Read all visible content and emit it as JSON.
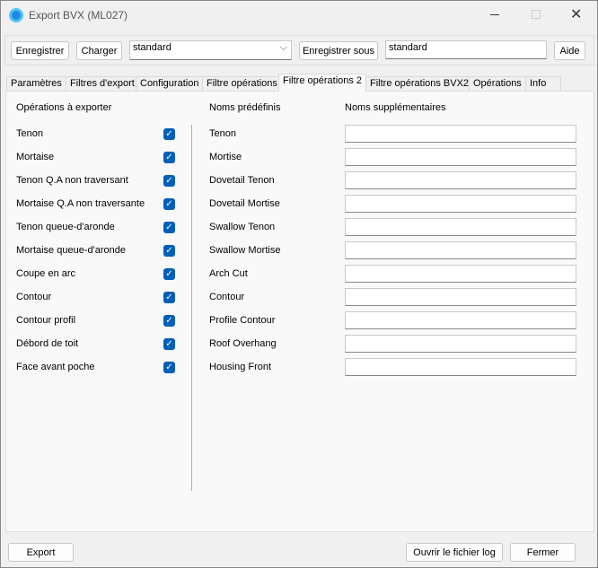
{
  "window": {
    "title": "Export BVX (ML027)"
  },
  "toolbar": {
    "save": "Enregistrer",
    "load": "Charger",
    "profile_select": "standard",
    "save_as": "Enregistrer sous",
    "save_as_name": "standard",
    "help": "Aide"
  },
  "tabs": [
    "Paramètres",
    "Filtres d'export",
    "Configuration",
    "Filtre opérations",
    "Filtre opérations 2",
    "Filtre opérations BVX2",
    "Opérations",
    "Info"
  ],
  "panel": {
    "col1_header": "Opérations à exporter",
    "col2_header": "Noms prédéfinis",
    "col3_header": "Noms supplémentaires",
    "rows": [
      {
        "op": "Tenon",
        "checked": true,
        "name": "Tenon",
        "extra": ""
      },
      {
        "op": "Mortaise",
        "checked": true,
        "name": "Mortise",
        "extra": ""
      },
      {
        "op": "Tenon Q.A non traversant",
        "checked": true,
        "name": "Dovetail Tenon",
        "extra": ""
      },
      {
        "op": "Mortaise Q.A non traversante",
        "checked": true,
        "name": "Dovetail Mortise",
        "extra": ""
      },
      {
        "op": "Tenon queue-d'aronde",
        "checked": true,
        "name": "Swallow Tenon",
        "extra": ""
      },
      {
        "op": "Mortaise queue-d'aronde",
        "checked": true,
        "name": "Swallow Mortise",
        "extra": ""
      },
      {
        "op": "Coupe en arc",
        "checked": true,
        "name": "Arch Cut",
        "extra": ""
      },
      {
        "op": "Contour",
        "checked": true,
        "name": "Contour",
        "extra": ""
      },
      {
        "op": "Contour profil",
        "checked": true,
        "name": "Profile Contour",
        "extra": ""
      },
      {
        "op": "Débord de toit",
        "checked": true,
        "name": "Roof Overhang",
        "extra": ""
      },
      {
        "op": "Face avant poche",
        "checked": true,
        "name": "Housing Front",
        "extra": ""
      }
    ]
  },
  "footer": {
    "export": "Export",
    "open_log": "Ouvrir le fichier log",
    "close": "Fermer"
  }
}
